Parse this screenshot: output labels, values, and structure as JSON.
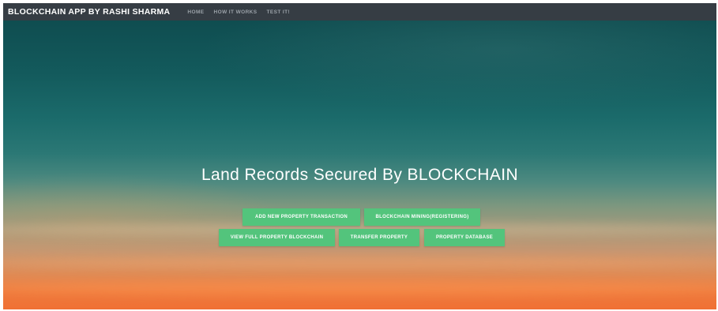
{
  "navbar": {
    "brand": "BLOCKCHAIN APP BY RASHI SHARMA",
    "links": [
      "HOME",
      "HOW IT WORKS",
      "TEST IT!"
    ],
    "background": "#363d44"
  },
  "hero": {
    "title": "Land Records Secured By BLOCKCHAIN",
    "buttons": [
      "ADD NEW PROPERTY TRANSACTION",
      "BLOCKCHAIN MINING(REGISTERING)",
      "VIEW FULL PROPERTY BLOCKCHAIN",
      "TRANSFER PROPERTY",
      "PROPERTY DATABASE"
    ],
    "button_color": "#53c47c"
  }
}
